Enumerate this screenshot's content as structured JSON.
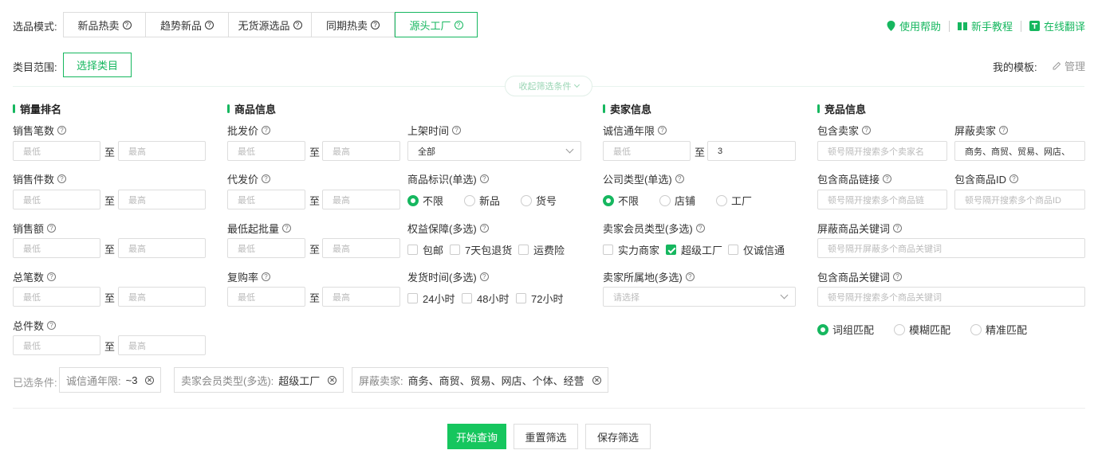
{
  "mode": {
    "label": "选品模式:",
    "tabs": [
      {
        "label": "新品热卖"
      },
      {
        "label": "趋势新品"
      },
      {
        "label": "无货源选品"
      },
      {
        "label": "同期热卖"
      },
      {
        "label": "源头工厂",
        "active": true
      }
    ]
  },
  "top_links": {
    "help": "使用帮助",
    "tutorial": "新手教程",
    "translate": "在线翻译"
  },
  "category": {
    "label": "类目范围:",
    "button": "选择类目"
  },
  "template": {
    "label": "我的模板:",
    "manage": "管理"
  },
  "collapse": "收起筛选条件",
  "range_sep": "至",
  "sales": {
    "title": "销量排名",
    "fields": [
      {
        "label": "销售笔数",
        "min": "最低",
        "max": "最高"
      },
      {
        "label": "销售件数",
        "min": "最低",
        "max": "最高"
      },
      {
        "label": "销售额",
        "min": "最低",
        "max": "最高"
      },
      {
        "label": "总笔数",
        "min": "最低",
        "max": "最高"
      },
      {
        "label": "总件数",
        "min": "最低",
        "max": "最高"
      }
    ]
  },
  "product": {
    "title": "商品信息",
    "ranges": [
      {
        "label": "批发价",
        "min": "最低",
        "max": "最高"
      },
      {
        "label": "代发价",
        "min": "最低",
        "max": "最高"
      },
      {
        "label": "最低起批量",
        "min": "最低",
        "max": "最高"
      },
      {
        "label": "复购率",
        "min": "最低",
        "max": "最高"
      }
    ],
    "listing_time": {
      "label": "上架时间",
      "value": "全部"
    },
    "tag": {
      "label": "商品标识(单选)",
      "options": [
        "不限",
        "新品",
        "货号"
      ]
    },
    "benefits": {
      "label": "权益保障(多选)",
      "options": [
        "包邮",
        "7天包退货",
        "运费险"
      ]
    },
    "ship_time": {
      "label": "发货时间(多选)",
      "options": [
        "24小时",
        "48小时",
        "72小时"
      ]
    }
  },
  "seller": {
    "title": "卖家信息",
    "years": {
      "label": "诚信通年限",
      "min": "最低",
      "max": "3"
    },
    "company_type": {
      "label": "公司类型(单选)",
      "options": [
        "不限",
        "店铺",
        "工厂"
      ]
    },
    "member_type": {
      "label": "卖家会员类型(多选)",
      "options": [
        "实力商家",
        "超级工厂",
        "仅诚信通"
      ]
    },
    "location": {
      "label": "卖家所属地(多选)",
      "placeholder": "请选择"
    }
  },
  "competitor": {
    "title": "竞品信息",
    "include_seller": {
      "label": "包含卖家",
      "placeholder": "顿号隔开搜索多个卖家名"
    },
    "block_seller": {
      "label": "屏蔽卖家",
      "value": "商务、商贸、贸易、网店、"
    },
    "include_link": {
      "label": "包含商品链接",
      "placeholder": "顿号隔开搜索多个商品链"
    },
    "include_id": {
      "label": "包含商品ID",
      "placeholder": "顿号隔开搜索多个商品ID"
    },
    "block_keywords": {
      "label": "屏蔽商品关键词",
      "placeholder": "顿号隔开屏蔽多个商品关键词"
    },
    "include_keywords": {
      "label": "包含商品关键词",
      "placeholder": "顿号隔开搜索多个商品关键词"
    },
    "match": [
      "词组匹配",
      "模糊匹配",
      "精准匹配"
    ]
  },
  "selected": {
    "label": "已选条件:",
    "chips": [
      {
        "key": "诚信通年限:",
        "value": "~3"
      },
      {
        "key": "卖家会员类型(多选):",
        "value": "超级工厂"
      },
      {
        "key": "屏蔽卖家:",
        "value": "商务、商贸、贸易、网店、个体、经营"
      }
    ]
  },
  "actions": {
    "search": "开始查询",
    "reset": "重置筛选",
    "save": "保存筛选"
  },
  "colors": {
    "accent": "#16b75f",
    "primary_button": "#16c65e"
  }
}
